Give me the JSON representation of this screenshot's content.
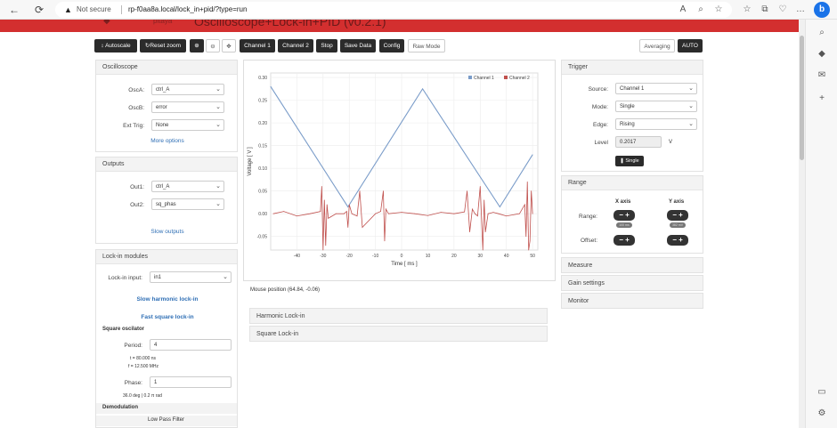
{
  "browser": {
    "back": "←",
    "reload": "⟳",
    "not_secure": "Not secure",
    "url": "rp-f0aa8a.local/lock_in+pid/?type=run",
    "profile_letter": "b"
  },
  "header": {
    "title": "Oscilloscope+Lock-in+PID (v0.2.1)",
    "logo_text": "pitaya"
  },
  "toolbar": {
    "autoscale": "↕ Autoscale",
    "reset_zoom": "↻Reset zoom",
    "zoom_in": "⊕",
    "zoom_out": "⊖",
    "pan": "✥",
    "channel1": "Channel 1",
    "channel2": "Channel 2",
    "stop": "Stop",
    "save_data": "Save Data",
    "config": "Config",
    "raw_mode": "Raw Mode",
    "averaging": "Averaging",
    "auto": "AUTO"
  },
  "oscilloscope": {
    "title": "Oscilloscope",
    "osca_label": "OscA:",
    "osca_value": "ctrl_A",
    "oscb_label": "OscB:",
    "oscb_value": "error",
    "ext_trig_label": "Ext Trig:",
    "ext_trig_value": "None",
    "more_options": "More options"
  },
  "outputs": {
    "title": "Outputs",
    "out1_label": "Out1:",
    "out1_value": "ctrl_A",
    "out2_label": "Out2:",
    "out2_value": "sq_phas",
    "slow_outputs": "Slow outputs"
  },
  "lockin": {
    "title": "Lock-in modules",
    "input_label": "Lock-in input:",
    "input_value": "in1",
    "slow_harmonic": "Slow harmonic lock-in",
    "fast_square": "Fast square lock-in",
    "square_osc": "Square oscilator",
    "period_label": "Period:",
    "period_value": "4",
    "t_text": "t = 80.000 ns",
    "f_text": "f = 12.500 MHz",
    "phase_label": "Phase:",
    "phase_value": "1",
    "phase_info": "36.0 deg | 0.2 π rad",
    "demod": "Demodulation",
    "lpf": "Low Pass Filter"
  },
  "chart_data": {
    "type": "line",
    "xlabel": "Time [ ms ]",
    "ylabel": "Voltage [ V ]",
    "xlim": [
      -50,
      52
    ],
    "ylim": [
      -0.08,
      0.31
    ],
    "x_ticks": [
      "-40",
      "-30",
      "-20",
      "-10",
      "0",
      "10",
      "20",
      "30",
      "40",
      "50"
    ],
    "y_ticks": [
      "0.30",
      "0.25",
      "0.20",
      "0.15",
      "0.10",
      "0.05",
      "0.00",
      "-0.05"
    ],
    "series": [
      {
        "name": "Channel 1",
        "color": "#7a9cc9",
        "x": [
          -50,
          -20.5,
          8,
          37.5,
          50
        ],
        "y": [
          0.28,
          0.015,
          0.275,
          0.015,
          0.13
        ]
      },
      {
        "name": "Channel 2",
        "color": "#c0504d",
        "x": [
          -49,
          -45,
          -40,
          -35,
          -31,
          -30.5,
          -30,
          -29.5,
          -29,
          -28.5,
          -28,
          -25,
          -22,
          -21,
          -20.5,
          -20,
          -19,
          -17,
          -16,
          -15,
          -10,
          -8,
          -7,
          -6.5,
          -6,
          -5,
          0,
          5,
          10,
          15,
          20,
          24,
          25,
          26,
          27,
          28,
          29,
          30,
          31,
          31.5,
          32,
          33,
          35,
          37,
          40,
          45,
          47,
          47.5,
          48,
          48.5,
          49,
          49.5,
          50
        ],
        "y": [
          0.0,
          0.005,
          -0.005,
          0.0,
          0.005,
          0.06,
          -0.08,
          0.03,
          -0.07,
          0.02,
          -0.01,
          0.0,
          0.0,
          0.005,
          -0.03,
          0.02,
          0.0,
          -0.005,
          0.05,
          -0.03,
          0.0,
          0.005,
          0.05,
          -0.06,
          0.01,
          0.0,
          0.003,
          0.0,
          -0.004,
          0.003,
          0.0,
          0.004,
          0.05,
          -0.04,
          0.01,
          0.0,
          -0.005,
          0.06,
          -0.08,
          0.03,
          -0.04,
          0.0,
          0.003,
          0.0,
          -0.005,
          0.0,
          0.02,
          -0.05,
          0.07,
          -0.08,
          -0.06,
          0.05,
          0.0
        ]
      }
    ]
  },
  "mouse_position": "Mouse position (64.84, -0.06)",
  "harmonic_lockin": "Harmonic Lock-in",
  "square_lockin": "Square Lock-in",
  "trigger": {
    "title": "Trigger",
    "source_label": "Source:",
    "source_value": "Channel 1",
    "mode_label": "Mode:",
    "mode_value": "Single",
    "edge_label": "Edge:",
    "edge_value": "Rising",
    "level_label": "Level",
    "level_value": "0.2017",
    "level_unit": "V",
    "single_btn": "❚ Single"
  },
  "range": {
    "title": "Range",
    "x_axis": "X axis",
    "y_axis": "Y axis",
    "range_label": "Range:",
    "offset_label": "Offset:",
    "x_range_val": "100 ms",
    "y_range_val": "382 mV",
    "pm": "− +"
  },
  "measure": "Measure",
  "gain_settings": "Gain settings",
  "monitor": "Monitor"
}
